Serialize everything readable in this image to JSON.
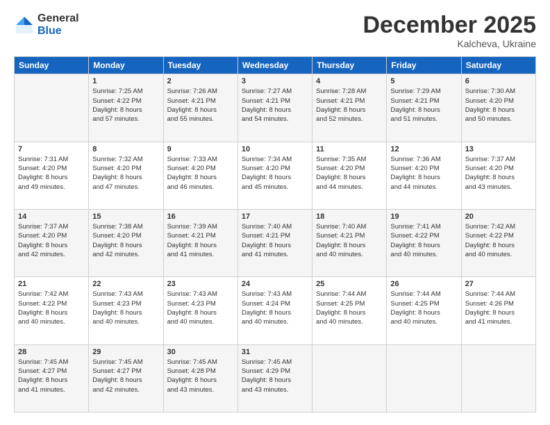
{
  "logo": {
    "general": "General",
    "blue": "Blue"
  },
  "header": {
    "month": "December 2025",
    "location": "Kalcheva, Ukraine"
  },
  "weekdays": [
    "Sunday",
    "Monday",
    "Tuesday",
    "Wednesday",
    "Thursday",
    "Friday",
    "Saturday"
  ],
  "weeks": [
    [
      {
        "day": "",
        "info": ""
      },
      {
        "day": "1",
        "info": "Sunrise: 7:25 AM\nSunset: 4:22 PM\nDaylight: 8 hours\nand 57 minutes."
      },
      {
        "day": "2",
        "info": "Sunrise: 7:26 AM\nSunset: 4:21 PM\nDaylight: 8 hours\nand 55 minutes."
      },
      {
        "day": "3",
        "info": "Sunrise: 7:27 AM\nSunset: 4:21 PM\nDaylight: 8 hours\nand 54 minutes."
      },
      {
        "day": "4",
        "info": "Sunrise: 7:28 AM\nSunset: 4:21 PM\nDaylight: 8 hours\nand 52 minutes."
      },
      {
        "day": "5",
        "info": "Sunrise: 7:29 AM\nSunset: 4:21 PM\nDaylight: 8 hours\nand 51 minutes."
      },
      {
        "day": "6",
        "info": "Sunrise: 7:30 AM\nSunset: 4:20 PM\nDaylight: 8 hours\nand 50 minutes."
      }
    ],
    [
      {
        "day": "7",
        "info": "Sunrise: 7:31 AM\nSunset: 4:20 PM\nDaylight: 8 hours\nand 49 minutes."
      },
      {
        "day": "8",
        "info": "Sunrise: 7:32 AM\nSunset: 4:20 PM\nDaylight: 8 hours\nand 47 minutes."
      },
      {
        "day": "9",
        "info": "Sunrise: 7:33 AM\nSunset: 4:20 PM\nDaylight: 8 hours\nand 46 minutes."
      },
      {
        "day": "10",
        "info": "Sunrise: 7:34 AM\nSunset: 4:20 PM\nDaylight: 8 hours\nand 45 minutes."
      },
      {
        "day": "11",
        "info": "Sunrise: 7:35 AM\nSunset: 4:20 PM\nDaylight: 8 hours\nand 44 minutes."
      },
      {
        "day": "12",
        "info": "Sunrise: 7:36 AM\nSunset: 4:20 PM\nDaylight: 8 hours\nand 44 minutes."
      },
      {
        "day": "13",
        "info": "Sunrise: 7:37 AM\nSunset: 4:20 PM\nDaylight: 8 hours\nand 43 minutes."
      }
    ],
    [
      {
        "day": "14",
        "info": "Sunrise: 7:37 AM\nSunset: 4:20 PM\nDaylight: 8 hours\nand 42 minutes."
      },
      {
        "day": "15",
        "info": "Sunrise: 7:38 AM\nSunset: 4:20 PM\nDaylight: 8 hours\nand 42 minutes."
      },
      {
        "day": "16",
        "info": "Sunrise: 7:39 AM\nSunset: 4:21 PM\nDaylight: 8 hours\nand 41 minutes."
      },
      {
        "day": "17",
        "info": "Sunrise: 7:40 AM\nSunset: 4:21 PM\nDaylight: 8 hours\nand 41 minutes."
      },
      {
        "day": "18",
        "info": "Sunrise: 7:40 AM\nSunset: 4:21 PM\nDaylight: 8 hours\nand 40 minutes."
      },
      {
        "day": "19",
        "info": "Sunrise: 7:41 AM\nSunset: 4:22 PM\nDaylight: 8 hours\nand 40 minutes."
      },
      {
        "day": "20",
        "info": "Sunrise: 7:42 AM\nSunset: 4:22 PM\nDaylight: 8 hours\nand 40 minutes."
      }
    ],
    [
      {
        "day": "21",
        "info": "Sunrise: 7:42 AM\nSunset: 4:22 PM\nDaylight: 8 hours\nand 40 minutes."
      },
      {
        "day": "22",
        "info": "Sunrise: 7:43 AM\nSunset: 4:23 PM\nDaylight: 8 hours\nand 40 minutes."
      },
      {
        "day": "23",
        "info": "Sunrise: 7:43 AM\nSunset: 4:23 PM\nDaylight: 8 hours\nand 40 minutes."
      },
      {
        "day": "24",
        "info": "Sunrise: 7:43 AM\nSunset: 4:24 PM\nDaylight: 8 hours\nand 40 minutes."
      },
      {
        "day": "25",
        "info": "Sunrise: 7:44 AM\nSunset: 4:25 PM\nDaylight: 8 hours\nand 40 minutes."
      },
      {
        "day": "26",
        "info": "Sunrise: 7:44 AM\nSunset: 4:25 PM\nDaylight: 8 hours\nand 40 minutes."
      },
      {
        "day": "27",
        "info": "Sunrise: 7:44 AM\nSunset: 4:26 PM\nDaylight: 8 hours\nand 41 minutes."
      }
    ],
    [
      {
        "day": "28",
        "info": "Sunrise: 7:45 AM\nSunset: 4:27 PM\nDaylight: 8 hours\nand 41 minutes."
      },
      {
        "day": "29",
        "info": "Sunrise: 7:45 AM\nSunset: 4:27 PM\nDaylight: 8 hours\nand 42 minutes."
      },
      {
        "day": "30",
        "info": "Sunrise: 7:45 AM\nSunset: 4:28 PM\nDaylight: 8 hours\nand 43 minutes."
      },
      {
        "day": "31",
        "info": "Sunrise: 7:45 AM\nSunset: 4:29 PM\nDaylight: 8 hours\nand 43 minutes."
      },
      {
        "day": "",
        "info": ""
      },
      {
        "day": "",
        "info": ""
      },
      {
        "day": "",
        "info": ""
      }
    ]
  ]
}
